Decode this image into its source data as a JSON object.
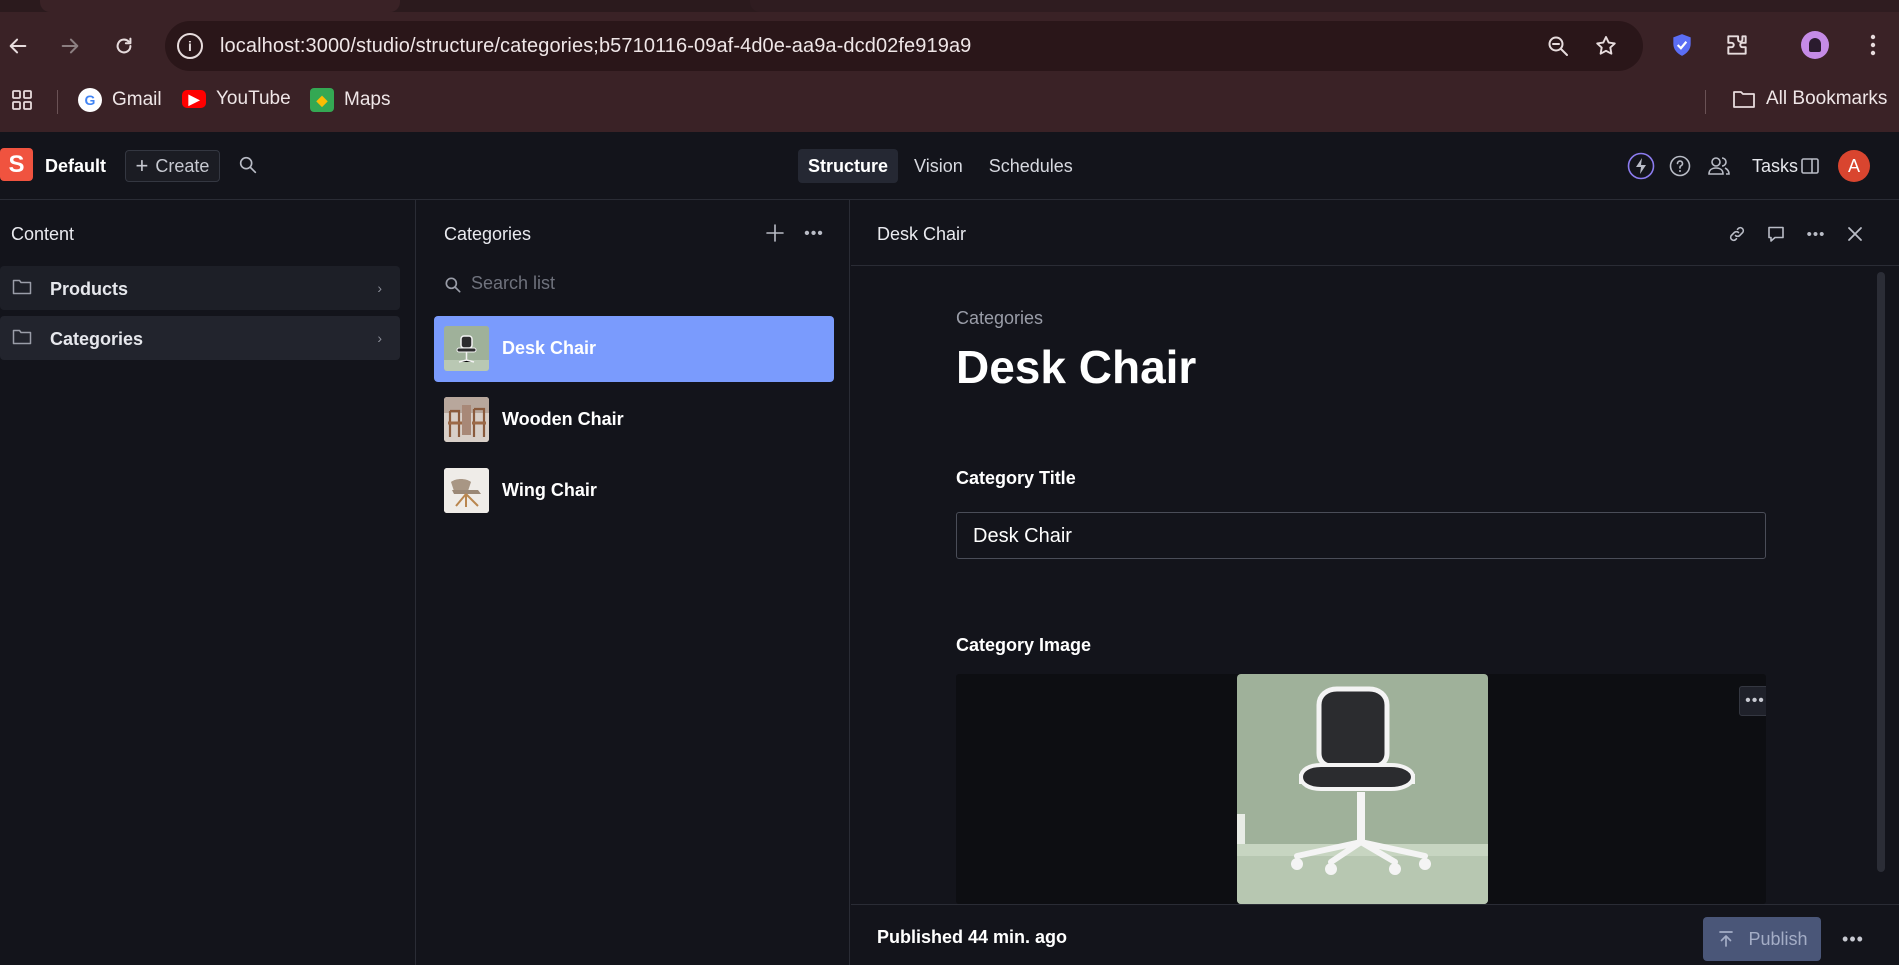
{
  "browser": {
    "url": "localhost:3000/studio/structure/categories;b5710116-09af-4d0e-aa9a-dcd02fe919a9",
    "bookmarks": [
      {
        "label": "Gmail",
        "icon": "gmail-icon"
      },
      {
        "label": "YouTube",
        "icon": "youtube-icon"
      },
      {
        "label": "Maps",
        "icon": "maps-icon"
      }
    ],
    "all_bookmarks_label": "All Bookmarks",
    "profile_initial": "",
    "colors": {
      "chrome": "#3a2226",
      "omnibox": "#2a1619"
    }
  },
  "studio": {
    "logo_letter": "S",
    "workspace": "Default",
    "create_label": "Create",
    "tabs": [
      {
        "label": "Structure",
        "active": true
      },
      {
        "label": "Vision",
        "active": false
      },
      {
        "label": "Schedules",
        "active": false
      }
    ],
    "tasks_label": "Tasks",
    "avatar_initial": "A",
    "accent": "#7a9bfd",
    "brand": "#f0533f"
  },
  "content_pane": {
    "title": "Content",
    "items": [
      {
        "label": "Products"
      },
      {
        "label": "Categories"
      }
    ]
  },
  "categories_pane": {
    "title": "Categories",
    "search_placeholder": "Search list",
    "items": [
      {
        "label": "Desk Chair",
        "selected": true
      },
      {
        "label": "Wooden Chair",
        "selected": false
      },
      {
        "label": "Wing Chair",
        "selected": false
      }
    ]
  },
  "document": {
    "header_title": "Desk Chair",
    "breadcrumb": "Categories",
    "heading": "Desk Chair",
    "fields": {
      "title_label": "Category Title",
      "title_value": "Desk Chair",
      "image_label": "Category Image"
    },
    "status": "Published 44 min. ago",
    "publish_label": "Publish"
  }
}
